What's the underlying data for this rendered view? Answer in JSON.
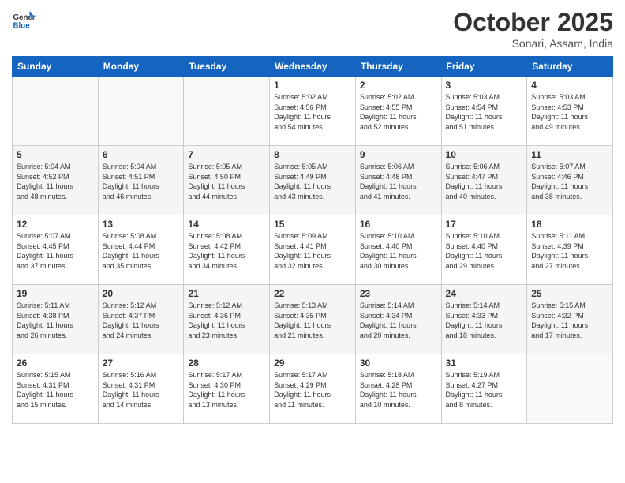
{
  "header": {
    "logo_line1": "General",
    "logo_line2": "Blue",
    "month": "October 2025",
    "location": "Sonari, Assam, India"
  },
  "weekdays": [
    "Sunday",
    "Monday",
    "Tuesday",
    "Wednesday",
    "Thursday",
    "Friday",
    "Saturday"
  ],
  "weeks": [
    [
      {
        "day": "",
        "info": ""
      },
      {
        "day": "",
        "info": ""
      },
      {
        "day": "",
        "info": ""
      },
      {
        "day": "1",
        "info": "Sunrise: 5:02 AM\nSunset: 4:56 PM\nDaylight: 11 hours\nand 54 minutes."
      },
      {
        "day": "2",
        "info": "Sunrise: 5:02 AM\nSunset: 4:55 PM\nDaylight: 11 hours\nand 52 minutes."
      },
      {
        "day": "3",
        "info": "Sunrise: 5:03 AM\nSunset: 4:54 PM\nDaylight: 11 hours\nand 51 minutes."
      },
      {
        "day": "4",
        "info": "Sunrise: 5:03 AM\nSunset: 4:53 PM\nDaylight: 11 hours\nand 49 minutes."
      }
    ],
    [
      {
        "day": "5",
        "info": "Sunrise: 5:04 AM\nSunset: 4:52 PM\nDaylight: 11 hours\nand 48 minutes."
      },
      {
        "day": "6",
        "info": "Sunrise: 5:04 AM\nSunset: 4:51 PM\nDaylight: 11 hours\nand 46 minutes."
      },
      {
        "day": "7",
        "info": "Sunrise: 5:05 AM\nSunset: 4:50 PM\nDaylight: 11 hours\nand 44 minutes."
      },
      {
        "day": "8",
        "info": "Sunrise: 5:05 AM\nSunset: 4:49 PM\nDaylight: 11 hours\nand 43 minutes."
      },
      {
        "day": "9",
        "info": "Sunrise: 5:06 AM\nSunset: 4:48 PM\nDaylight: 11 hours\nand 41 minutes."
      },
      {
        "day": "10",
        "info": "Sunrise: 5:06 AM\nSunset: 4:47 PM\nDaylight: 11 hours\nand 40 minutes."
      },
      {
        "day": "11",
        "info": "Sunrise: 5:07 AM\nSunset: 4:46 PM\nDaylight: 11 hours\nand 38 minutes."
      }
    ],
    [
      {
        "day": "12",
        "info": "Sunrise: 5:07 AM\nSunset: 4:45 PM\nDaylight: 11 hours\nand 37 minutes."
      },
      {
        "day": "13",
        "info": "Sunrise: 5:08 AM\nSunset: 4:44 PM\nDaylight: 11 hours\nand 35 minutes."
      },
      {
        "day": "14",
        "info": "Sunrise: 5:08 AM\nSunset: 4:42 PM\nDaylight: 11 hours\nand 34 minutes."
      },
      {
        "day": "15",
        "info": "Sunrise: 5:09 AM\nSunset: 4:41 PM\nDaylight: 11 hours\nand 32 minutes."
      },
      {
        "day": "16",
        "info": "Sunrise: 5:10 AM\nSunset: 4:40 PM\nDaylight: 11 hours\nand 30 minutes."
      },
      {
        "day": "17",
        "info": "Sunrise: 5:10 AM\nSunset: 4:40 PM\nDaylight: 11 hours\nand 29 minutes."
      },
      {
        "day": "18",
        "info": "Sunrise: 5:11 AM\nSunset: 4:39 PM\nDaylight: 11 hours\nand 27 minutes."
      }
    ],
    [
      {
        "day": "19",
        "info": "Sunrise: 5:11 AM\nSunset: 4:38 PM\nDaylight: 11 hours\nand 26 minutes."
      },
      {
        "day": "20",
        "info": "Sunrise: 5:12 AM\nSunset: 4:37 PM\nDaylight: 11 hours\nand 24 minutes."
      },
      {
        "day": "21",
        "info": "Sunrise: 5:12 AM\nSunset: 4:36 PM\nDaylight: 11 hours\nand 23 minutes."
      },
      {
        "day": "22",
        "info": "Sunrise: 5:13 AM\nSunset: 4:35 PM\nDaylight: 11 hours\nand 21 minutes."
      },
      {
        "day": "23",
        "info": "Sunrise: 5:14 AM\nSunset: 4:34 PM\nDaylight: 11 hours\nand 20 minutes."
      },
      {
        "day": "24",
        "info": "Sunrise: 5:14 AM\nSunset: 4:33 PM\nDaylight: 11 hours\nand 18 minutes."
      },
      {
        "day": "25",
        "info": "Sunrise: 5:15 AM\nSunset: 4:32 PM\nDaylight: 11 hours\nand 17 minutes."
      }
    ],
    [
      {
        "day": "26",
        "info": "Sunrise: 5:15 AM\nSunset: 4:31 PM\nDaylight: 11 hours\nand 15 minutes."
      },
      {
        "day": "27",
        "info": "Sunrise: 5:16 AM\nSunset: 4:31 PM\nDaylight: 11 hours\nand 14 minutes."
      },
      {
        "day": "28",
        "info": "Sunrise: 5:17 AM\nSunset: 4:30 PM\nDaylight: 11 hours\nand 13 minutes."
      },
      {
        "day": "29",
        "info": "Sunrise: 5:17 AM\nSunset: 4:29 PM\nDaylight: 11 hours\nand 11 minutes."
      },
      {
        "day": "30",
        "info": "Sunrise: 5:18 AM\nSunset: 4:28 PM\nDaylight: 11 hours\nand 10 minutes."
      },
      {
        "day": "31",
        "info": "Sunrise: 5:19 AM\nSunset: 4:27 PM\nDaylight: 11 hours\nand 8 minutes."
      },
      {
        "day": "",
        "info": ""
      }
    ]
  ]
}
